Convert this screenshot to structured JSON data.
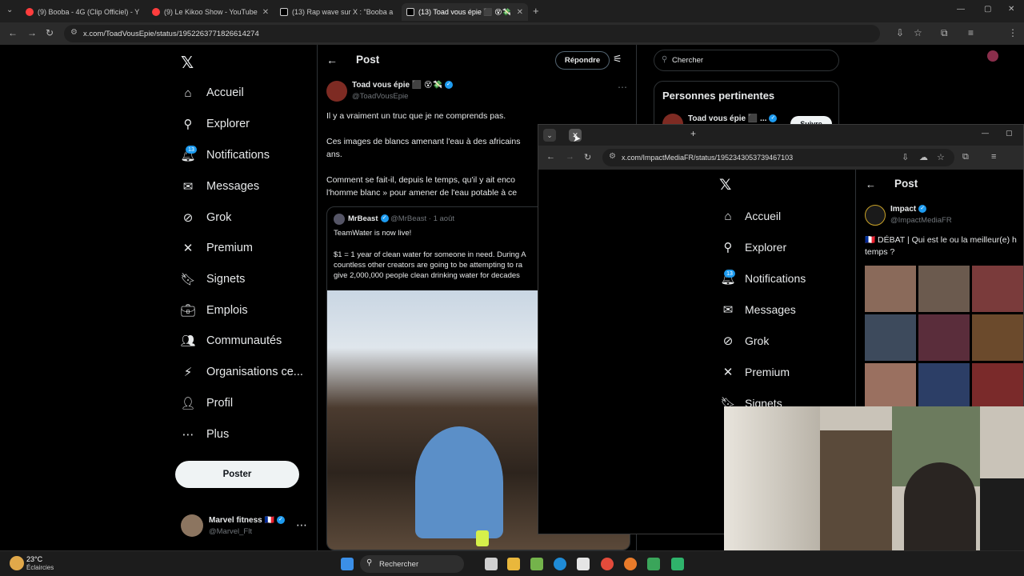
{
  "browser": {
    "tabs": [
      {
        "title": "(9) Booba - 4G (Clip Officiel) - Y"
      },
      {
        "title": "(9) Le Kikoo Show - YouTube"
      },
      {
        "title": "(13) Rap wave sur X : \"Booba a"
      },
      {
        "title": "(13) Toad vous épie ⬛ 😵💸"
      }
    ],
    "url": "x.com/ToadVousEpie/status/1952263771826614274"
  },
  "sidebar": {
    "items": [
      {
        "label": "Accueil",
        "icon": "home-icon"
      },
      {
        "label": "Explorer",
        "icon": "search-icon"
      },
      {
        "label": "Notifications",
        "icon": "bell-icon",
        "badge": "13"
      },
      {
        "label": "Messages",
        "icon": "mail-icon"
      },
      {
        "label": "Grok",
        "icon": "grok-icon"
      },
      {
        "label": "Premium",
        "icon": "x-logo-icon"
      },
      {
        "label": "Signets",
        "icon": "bookmark-icon"
      },
      {
        "label": "Emplois",
        "icon": "briefcase-icon"
      },
      {
        "label": "Communautés",
        "icon": "people-icon"
      },
      {
        "label": "Organisations ce...",
        "icon": "bolt-icon"
      },
      {
        "label": "Profil",
        "icon": "user-icon"
      },
      {
        "label": "Plus",
        "icon": "more-circle-icon"
      }
    ],
    "post_button": "Poster",
    "account": {
      "name": "Marvel fitness 🇫🇷",
      "handle": "@Marvel_Flt"
    }
  },
  "main": {
    "header": "Post",
    "reply_button": "Répondre",
    "author": {
      "name": "Toad vous épie ⬛ 😵💸",
      "handle": "@ToadVousEpie"
    },
    "lines": [
      "Il y a vraiment un truc que je ne comprends pas.",
      "Ces images de blancs amenant l'eau à des africains",
      "ans.",
      "Comment se fait-il, depuis le temps, qu'il y ait enco",
      "l'homme blanc » pour amener de l'eau potable à ce"
    ],
    "quote": {
      "name": "MrBeast",
      "handle": "@MrBeast",
      "date": "· 1 août",
      "line1": "TeamWater is now live!",
      "line2": "$1 = 1 year of clean water for someone in need. During A",
      "line3": "countless other creators are going to be attempting to ra",
      "line4": "give 2,000,000 people clean drinking water for decades"
    }
  },
  "right": {
    "search_placeholder": "Chercher",
    "section_title": "Personnes pertinentes",
    "person": "Toad vous épie ⬛ ...",
    "follow": "Suivre"
  },
  "window2": {
    "url": "x.com/ImpactMediaFR/status/1952343053739467103",
    "nav": [
      {
        "label": "Accueil",
        "icon": "home-icon"
      },
      {
        "label": "Explorer",
        "icon": "search-icon"
      },
      {
        "label": "Notifications",
        "icon": "bell-icon",
        "badge": "13"
      },
      {
        "label": "Messages",
        "icon": "mail-icon"
      },
      {
        "label": "Grok",
        "icon": "grok-icon"
      },
      {
        "label": "Premium",
        "icon": "x-logo-icon"
      },
      {
        "label": "Signets",
        "icon": "bookmark-icon"
      }
    ],
    "header": "Post",
    "author": {
      "name": "Impact",
      "handle": "@ImpactMediaFR"
    },
    "text_line1": "🇫🇷 DÉBAT | Qui est le ou la meilleur(e) h",
    "text_line2": "temps ?"
  },
  "taskbar": {
    "weather_temp": "23°C",
    "weather_desc": "Éclaircies",
    "search": "Rechercher"
  }
}
